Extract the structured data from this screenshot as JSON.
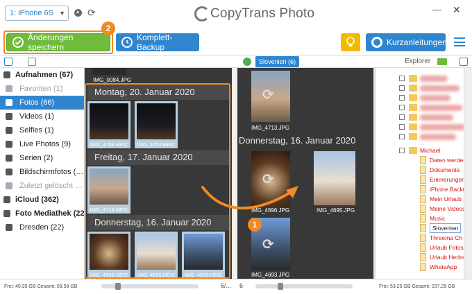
{
  "app": {
    "title": "CopyTrans Photo",
    "device": "1: iPhone 6S"
  },
  "toolbar": {
    "save_label": "Änderungen speichern",
    "backup_label": "Komplett-Backup",
    "guides_label": "Kurzanleitungen",
    "badge_save": "2",
    "badge_drag": "1"
  },
  "subheader": {
    "album_tab": "Slovenien (6)",
    "explorer_label": "Explorer"
  },
  "sidebar": {
    "items": [
      {
        "label": "Aufnahmen (67)",
        "type": "header",
        "icon": "camera-roll-icon"
      },
      {
        "label": "Favoriten (1)",
        "type": "dim",
        "icon": "heart-icon"
      },
      {
        "label": "Fotos (66)",
        "type": "selected",
        "icon": "camera-icon"
      },
      {
        "label": "Videos (1)",
        "type": "normal",
        "icon": "video-icon"
      },
      {
        "label": "Selfies (1)",
        "type": "normal",
        "icon": "selfie-icon"
      },
      {
        "label": "Live Photos (9)",
        "type": "normal",
        "icon": "live-photo-icon"
      },
      {
        "label": "Serien (2)",
        "type": "normal",
        "icon": "burst-icon"
      },
      {
        "label": "Bildschirmfotos (…",
        "type": "normal",
        "icon": "screenshot-icon"
      },
      {
        "label": "Zuletzt gelöscht …",
        "type": "dim",
        "icon": "trash-icon"
      },
      {
        "label": "iCloud (362)",
        "type": "header",
        "icon": "cloud-icon"
      },
      {
        "label": "Foto Mediathek (22)",
        "type": "header",
        "icon": "library-icon"
      },
      {
        "label": "Dresden (22)",
        "type": "normal",
        "icon": "album-icon"
      }
    ]
  },
  "pane_iphone": {
    "top_file": "IMG_0084.JPG",
    "groups": [
      {
        "date": "Montag, 20. Januar 2020",
        "files": [
          "IMG_4754.HEIC",
          "IMG_4753.HEIC"
        ]
      },
      {
        "date": "Freitag, 17. Januar 2020",
        "files": [
          "IMG_4713.HEIC"
        ]
      },
      {
        "date": "Donnerstag, 16. Januar 2020",
        "files": [
          "IMG_4696.HEIC",
          "IMG_4695.HEIC",
          "IMG_4693.HEIC"
        ]
      }
    ],
    "counter": "6/..."
  },
  "pane_album": {
    "top_file": "IMG_4713.JPG",
    "date": "Donnerstag, 16. Januar 2020",
    "files": [
      "IMG_4696.JPG",
      "IMG_4695.JPG",
      "IMG_4693.JPG"
    ],
    "counter": "6"
  },
  "explorer": {
    "folder": "Michael",
    "selected": "Slovenien",
    "items": [
      "Daten werden",
      "Dokumente",
      "Erinnerungen",
      "iPhone Backu",
      "Mein Urlaub",
      "Meine Videos",
      "Music",
      "Slovenien",
      "Threema Ch",
      "Urlaub Fotos",
      "Urlaub Herbs",
      "WhatsApp"
    ]
  },
  "status": {
    "left": "Frei: 40.35 GB Gesamt: 59.58 GB",
    "right": "Frei: 53.25 GB Gesamt: 237.29 GB"
  },
  "colors": {
    "accent_blue": "#2f86cf",
    "save_green": "#6fbb3b",
    "highlight_orange": "#f08a25",
    "pane_dark": "#383838",
    "tip_yellow": "#f5b800"
  }
}
